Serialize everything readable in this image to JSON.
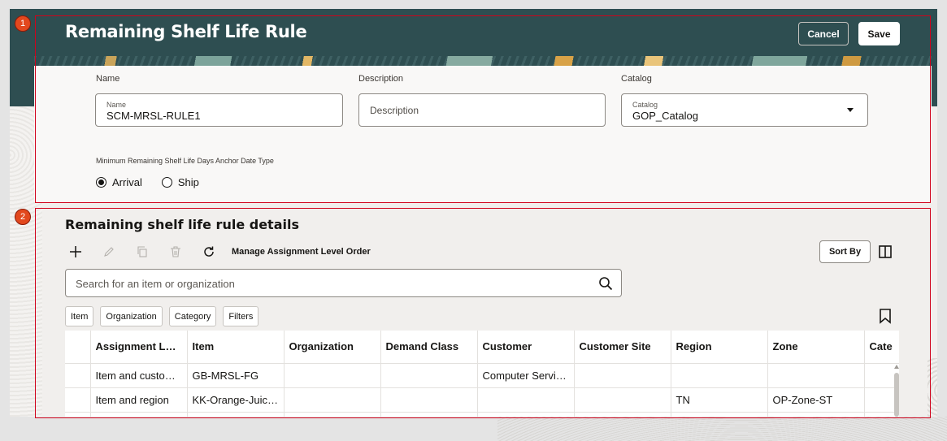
{
  "header": {
    "title": "Remaining Shelf Life Rule",
    "cancel_label": "Cancel",
    "save_label": "Save"
  },
  "form": {
    "name": {
      "label": "Name",
      "mini_label": "Name",
      "value": "SCM-MRSL-RULE1"
    },
    "description": {
      "label": "Description",
      "placeholder": "Description",
      "value": ""
    },
    "catalog": {
      "label": "Catalog",
      "mini_label": "Catalog",
      "value": "GOP_Catalog"
    },
    "anchor": {
      "label": "Minimum Remaining Shelf Life Days Anchor Date Type",
      "options": [
        {
          "label": "Arrival",
          "selected": true
        },
        {
          "label": "Ship",
          "selected": false
        }
      ]
    }
  },
  "details": {
    "title": "Remaining shelf life rule details",
    "toolbar": {
      "icons": [
        "add-icon",
        "edit-icon",
        "duplicate-icon",
        "delete-icon",
        "refresh-icon"
      ],
      "manage_label": "Manage Assignment Level Order",
      "sort_label": "Sort By"
    },
    "search": {
      "placeholder": "Search for an item or organization"
    },
    "chips": [
      "Item",
      "Organization",
      "Category",
      "Filters"
    ],
    "table": {
      "columns": [
        "Assignment Level",
        "Item",
        "Organization",
        "Demand Class",
        "Customer",
        "Customer Site",
        "Region",
        "Zone",
        "Cate"
      ],
      "rows": [
        [
          "Item and custo…",
          "GB-MRSL-FG",
          "",
          "",
          "Computer Servi…",
          "",
          "",
          "",
          ""
        ],
        [
          "Item and region",
          "KK-Orange-Juic…",
          "",
          "",
          "",
          "",
          "TN",
          "OP-Zone-ST",
          ""
        ]
      ]
    }
  },
  "annotations": [
    "1",
    "2"
  ],
  "colors": {
    "header_bg": "#2e4e51",
    "annotation": "#d0021b",
    "badge": "#e2481e"
  }
}
